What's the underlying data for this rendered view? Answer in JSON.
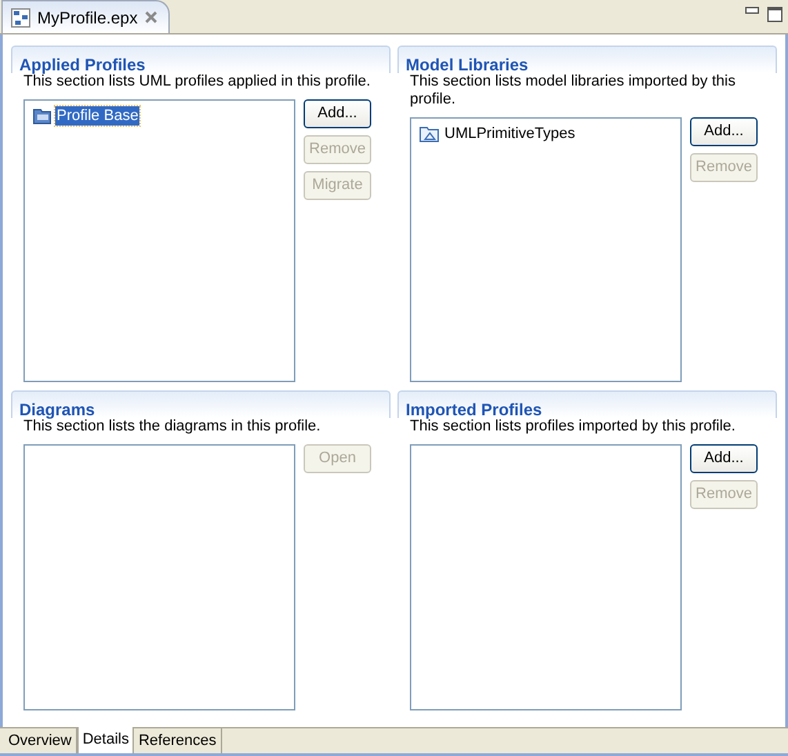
{
  "editor_tab": {
    "title": "MyProfile.epx"
  },
  "sections": [
    {
      "title": "Applied Profiles",
      "description": "This section lists UML profiles applied in this profile.",
      "items": [
        {
          "kind": "profile",
          "label": "Profile Base",
          "selected": true
        }
      ],
      "buttons": [
        {
          "label": "Add...",
          "disabled": false
        },
        {
          "label": "Remove",
          "disabled": true
        },
        {
          "label": "Migrate",
          "disabled": true
        }
      ]
    },
    {
      "title": "Model Libraries",
      "description": "This section lists model libraries imported by this profile.",
      "items": [
        {
          "kind": "library",
          "label": "UMLPrimitiveTypes",
          "selected": false
        }
      ],
      "buttons": [
        {
          "label": "Add...",
          "disabled": false
        },
        {
          "label": "Remove",
          "disabled": true
        }
      ]
    },
    {
      "title": "Diagrams",
      "description": "This section lists the diagrams in this profile.",
      "buttons": [
        {
          "label": "Open",
          "disabled": true
        }
      ]
    },
    {
      "title": "Imported Profiles",
      "description": "This section lists profiles imported by this profile.",
      "buttons": [
        {
          "label": "Add...",
          "disabled": false
        },
        {
          "label": "Remove",
          "disabled": true
        }
      ]
    }
  ],
  "page_tabs": [
    {
      "label": "Overview",
      "selected": false
    },
    {
      "label": "Details",
      "selected": true
    },
    {
      "label": "References",
      "selected": false
    }
  ]
}
